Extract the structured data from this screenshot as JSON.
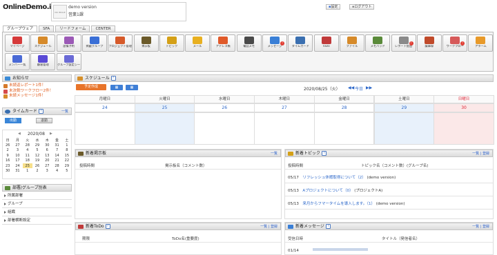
{
  "brand": "OnlineDemo.inc",
  "user": {
    "avatar": "NO IMAGE",
    "name": "demo version",
    "org": "営業1課"
  },
  "topbar": {
    "settings": "設定",
    "logout": "ログアウト"
  },
  "tabs": [
    "グループウェア",
    "SFA",
    "リードフォーム",
    "CENTER"
  ],
  "icons": [
    {
      "label": "マイページ",
      "color": "#d63a3a",
      "icon": "home-icon"
    },
    {
      "label": "スケジュール",
      "color": "#d68a2a",
      "icon": "calendar-icon"
    },
    {
      "label": "設備予約",
      "color": "#9b59b6",
      "icon": "facility-icon"
    },
    {
      "label": "掲載グループ",
      "color": "#3a6fd6",
      "icon": "group-icon"
    },
    {
      "label": "プロジェクト管理",
      "color": "#d65a2a",
      "icon": "project-icon"
    },
    {
      "label": "掲示板",
      "color": "#6b5a2a",
      "icon": "board-icon"
    },
    {
      "label": "トピック",
      "color": "#d4a017",
      "icon": "topic-icon"
    },
    {
      "label": "メール",
      "color": "#e8b020",
      "icon": "mail-icon"
    },
    {
      "label": "アドレス帳",
      "color": "#e05a2a",
      "icon": "address-book-icon"
    },
    {
      "label": "電話メモ",
      "color": "#4a4a4a",
      "icon": "phone-memo-icon"
    },
    {
      "label": "メッセージ",
      "color": "#3a7fd6",
      "icon": "message-icon",
      "badge": "!"
    },
    {
      "label": "タイムカード",
      "color": "#3a6fb0",
      "icon": "timecard-icon"
    },
    {
      "label": "ToDo",
      "color": "#c03a3a",
      "icon": "todo-icon"
    },
    {
      "label": "ファイル",
      "color": "#d68a2a",
      "icon": "file-icon"
    },
    {
      "label": "メモパッド",
      "color": "#5a8a3a",
      "icon": "memopad-icon"
    },
    {
      "label": "レポート提出",
      "color": "#8a8a8a",
      "icon": "report-icon",
      "badge": "!"
    },
    {
      "label": "議事録",
      "color": "#c04a2a",
      "icon": "minutes-icon"
    },
    {
      "label": "ワークフロー",
      "color": "#d65a5a",
      "icon": "workflow-icon",
      "badge": "!"
    },
    {
      "label": "アラーム",
      "color": "#e89a2a",
      "icon": "alarm-icon"
    },
    {
      "label": "メンバー一覧",
      "color": "#4a6ad6",
      "icon": "members-icon"
    },
    {
      "label": "顧客管理",
      "color": "#5a4ad6",
      "icon": "customer-icon"
    },
    {
      "label": "グループ設定シー",
      "color": "#6a6ad6",
      "icon": "group-settings-icon"
    }
  ],
  "notice": {
    "title": "お知らせ",
    "items": [
      "未読返レポート1件！",
      "未決裁ワークフロー2件！",
      "未読メッセージ1件！"
    ]
  },
  "timecard": {
    "title": "タイムカード",
    "help": "?",
    "link": "一覧",
    "in": "出勤",
    "out": "退勤"
  },
  "calendar": {
    "label": "2020/08",
    "weekdays": [
      "日",
      "月",
      "火",
      "水",
      "木",
      "金",
      "土"
    ],
    "weeks": [
      [
        "26",
        "27",
        "28",
        "29",
        "30",
        "31",
        "1"
      ],
      [
        "2",
        "3",
        "4",
        "5",
        "6",
        "7",
        "8"
      ],
      [
        "9",
        "10",
        "11",
        "12",
        "13",
        "14",
        "15"
      ],
      [
        "16",
        "17",
        "18",
        "19",
        "20",
        "21",
        "22"
      ],
      [
        "23",
        "24",
        "25",
        "26",
        "27",
        "28",
        "29"
      ],
      [
        "30",
        "31",
        "1",
        "2",
        "3",
        "4",
        "5"
      ]
    ]
  },
  "nav": {
    "title": "部署/グループ別表",
    "items": [
      "所属部署",
      "グループ",
      "組織",
      "部署横断設定"
    ]
  },
  "schedule": {
    "title": "スケジュール",
    "help": "?",
    "new": "予定作成",
    "date": "2020/08/25（火）",
    "today": "今日",
    "weekdays": [
      "月曜日",
      "火曜日",
      "水曜日",
      "木曜日",
      "金曜日",
      "土曜日",
      "日曜日"
    ],
    "dates": [
      "24",
      "25",
      "26",
      "27",
      "28",
      "29",
      "30"
    ]
  },
  "board": {
    "title": "新着掲示板",
    "link": "一覧",
    "col1": "投稿時間",
    "col2": "掲示板名（コメント数）"
  },
  "topics": {
    "title": "新着トピック",
    "help": "?",
    "link1": "一覧",
    "link2": "登録",
    "col1": "投稿時間",
    "col2": "トピック名（コメント数）(グループ名)",
    "rows": [
      {
        "date": "05/17",
        "title": "リフレッシュ休暇取得について（2）",
        "group": "(demo version)"
      },
      {
        "date": "05/13",
        "title": "Aプロジェクトについて（0）",
        "group": "(プロジェクトA)"
      },
      {
        "date": "05/13",
        "title": "来月からフマータイムを導入します。（1）",
        "group": "(demo version)"
      }
    ]
  },
  "todo": {
    "title": "新着ToDo",
    "help": "?",
    "link1": "一覧",
    "link2": "登録",
    "col1": "期限",
    "col2": "ToDo名(重要度)"
  },
  "messages": {
    "title": "新着メッセージ",
    "help": "?",
    "link1": "一覧",
    "link2": "登録",
    "col1": "受信日時",
    "col2": "タイトル（発信者名）",
    "rows": [
      {
        "date": "01/14"
      }
    ]
  }
}
